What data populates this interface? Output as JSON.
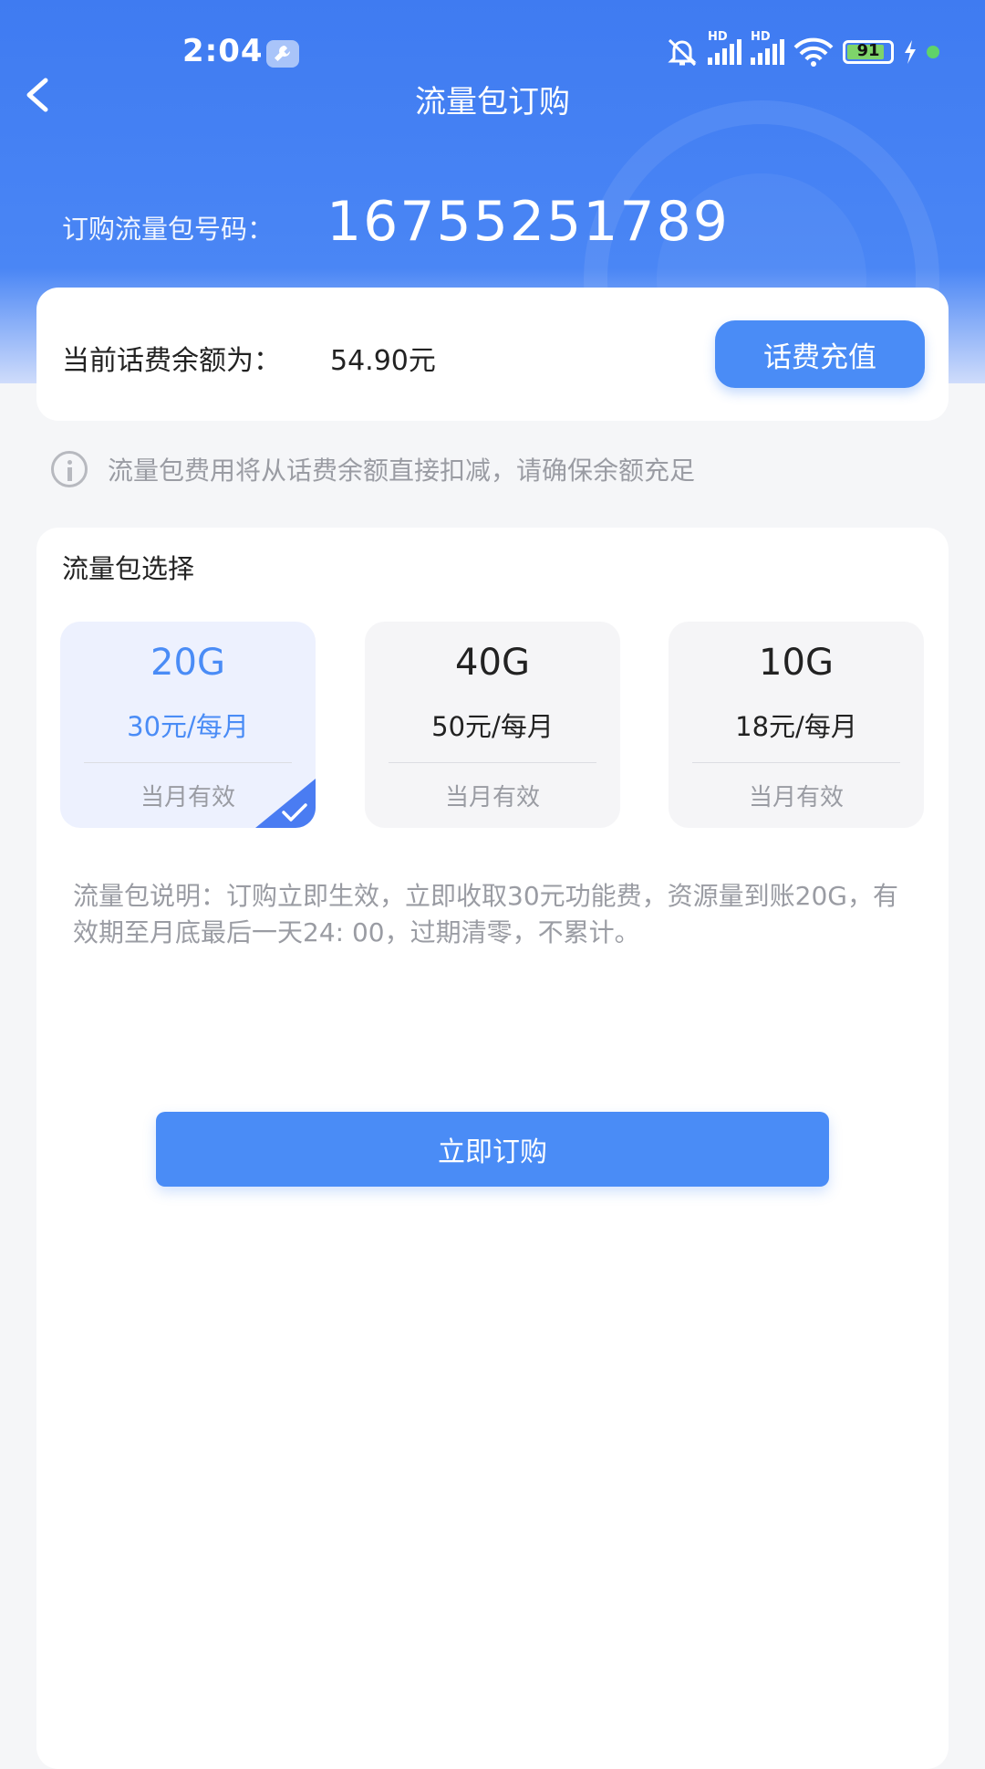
{
  "status_bar": {
    "time": "2:04",
    "battery": "91"
  },
  "nav": {
    "title": "流量包订购"
  },
  "header": {
    "phone_label": "订购流量包号码：",
    "phone_number": "16755251789"
  },
  "balance": {
    "label": "当前话费余额为：",
    "value": "54.90元",
    "recharge_label": "话费充值"
  },
  "notice": {
    "text": "流量包费用将从话费余额直接扣减，请确保余额充足"
  },
  "packages": {
    "title": "流量包选择",
    "selected_index": 0,
    "items": [
      {
        "size": "20G",
        "price": "30元/每月",
        "validity": "当月有效"
      },
      {
        "size": "40G",
        "price": "50元/每月",
        "validity": "当月有效"
      },
      {
        "size": "10G",
        "price": "18元/每月",
        "validity": "当月有效"
      }
    ]
  },
  "description": "流量包说明：订购立即生效，立即收取30元功能费，资源量到账20G，有效期至月底最后一天24: 00，过期清零，不累计。",
  "order_button": "立即订购",
  "colors": {
    "primary": "#4a8cf6",
    "header": "#3f7bf1",
    "selected_bg": "#edf1fe"
  }
}
